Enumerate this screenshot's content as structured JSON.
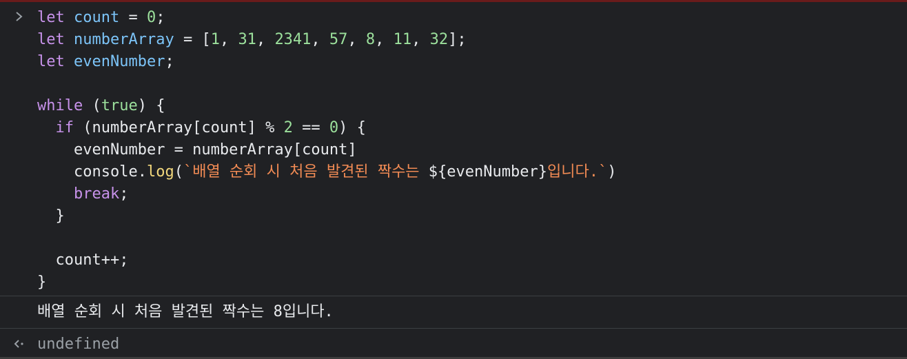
{
  "console": {
    "input_code": {
      "line1": {
        "kw": "let",
        "var": "count",
        "op": " = ",
        "num": "0",
        "end": ";"
      },
      "line2": {
        "kw": "let",
        "var": "numberArray",
        "op": " = [",
        "n1": "1",
        "n2": "31",
        "n3": "2341",
        "n4": "57",
        "n5": "8",
        "n6": "11",
        "n7": "32",
        "sep": ", ",
        "end": "];"
      },
      "line3": {
        "kw": "let",
        "var": "evenNumber",
        "end": ";"
      },
      "line5": {
        "kw": "while",
        "open": " (",
        "lit": "true",
        "close": ") {"
      },
      "line6": {
        "kw": "if",
        "a": " (numberArray[count] % ",
        "n": "2",
        "b": " == ",
        "z": "0",
        "c": ") {"
      },
      "line7": {
        "text": "evenNumber = numberArray[count]"
      },
      "line8": {
        "obj": "console.",
        "fn": "log",
        "paren": "(",
        "str1": "`배열 순회 시 처음 발견된 짝수는 ",
        "tmpl": "${evenNumber}",
        "str2": "입니다.`",
        "close": ")"
      },
      "line9": {
        "kw": "break",
        "end": ";"
      },
      "line10": {
        "text": "}"
      },
      "line12": {
        "text": "count++;"
      },
      "line13": {
        "text": "}"
      }
    },
    "output": "배열 순회 시 처음 발견된 짝수는 8입니다.",
    "return_value": "undefined"
  },
  "icons": {
    "prompt": "chevron-right-icon",
    "return": "return-arrow-icon"
  },
  "colors": {
    "background": "#202124",
    "keyword": "#c792ea",
    "variable": "#7cc4f8",
    "number": "#9ce09c",
    "function": "#f2d77c",
    "string": "#f28b54",
    "text": "#e8eaed",
    "muted": "#9aa0a6"
  }
}
